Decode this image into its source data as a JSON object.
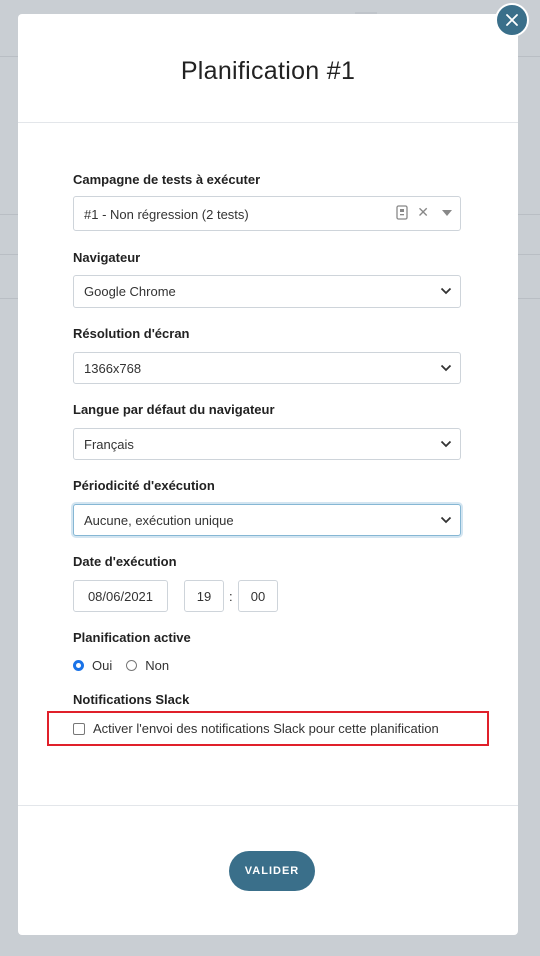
{
  "modal": {
    "title": "Planification #1",
    "submit_label": "VALIDER"
  },
  "fields": {
    "campaign": {
      "label": "Campagne de tests à exécuter",
      "value": "#1 - Non régression (2 tests)"
    },
    "browser": {
      "label": "Navigateur",
      "value": "Google Chrome"
    },
    "resolution": {
      "label": "Résolution d'écran",
      "value": "1366x768"
    },
    "language": {
      "label": "Langue par défaut du navigateur",
      "value": "Français"
    },
    "periodicity": {
      "label": "Périodicité d'exécution",
      "value": "Aucune, exécution unique"
    },
    "execution_date": {
      "label": "Date d'exécution",
      "date": "08/06/2021",
      "hour": "19",
      "separator": ":",
      "minute": "00"
    },
    "active": {
      "label": "Planification active",
      "options": [
        "Oui",
        "Non"
      ],
      "selected": "Oui"
    },
    "slack": {
      "label": "Notifications Slack",
      "checkbox_label": "Activer l'envoi des notifications Slack pour cette planification",
      "checked": false
    }
  },
  "icons": {
    "close": "close-icon",
    "chevron": "chevron-down-icon",
    "tag": "clipboard-icon",
    "clear": "clear-icon"
  },
  "colors": {
    "accent": "#3a6f8a",
    "highlight": "#e0202a",
    "radio_checked": "#1a73e8"
  }
}
